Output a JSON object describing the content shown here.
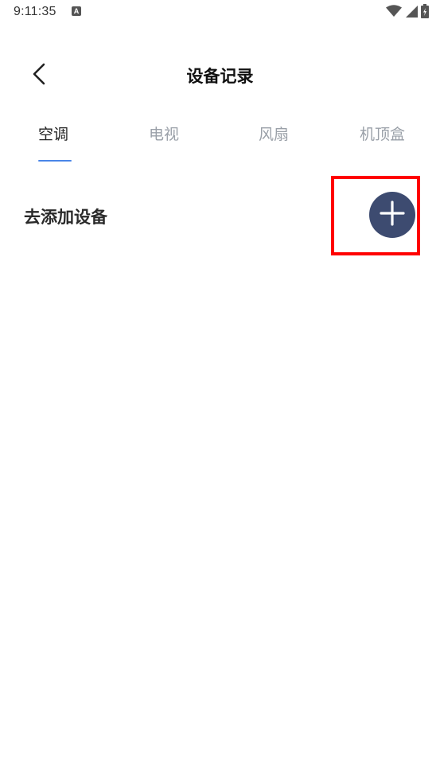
{
  "status_bar": {
    "time": "9:11:35",
    "notification_icon_letter": "A",
    "icons": [
      "wifi-icon",
      "signal-icon",
      "battery-icon"
    ]
  },
  "header": {
    "title": "设备记录",
    "back_icon": "chevron-left-icon"
  },
  "tabs": [
    {
      "label": "空调",
      "active": true
    },
    {
      "label": "电视",
      "active": false
    },
    {
      "label": "风扇",
      "active": false
    },
    {
      "label": "机顶盒",
      "active": false
    }
  ],
  "add_device": {
    "label": "去添加设备",
    "button_icon": "plus-icon"
  },
  "colors": {
    "tab_active": "#222222",
    "tab_inactive": "#9aa0a8",
    "tab_indicator": "#4a86e8",
    "add_button_bg": "#3d4b70",
    "highlight": "#ff0000"
  }
}
